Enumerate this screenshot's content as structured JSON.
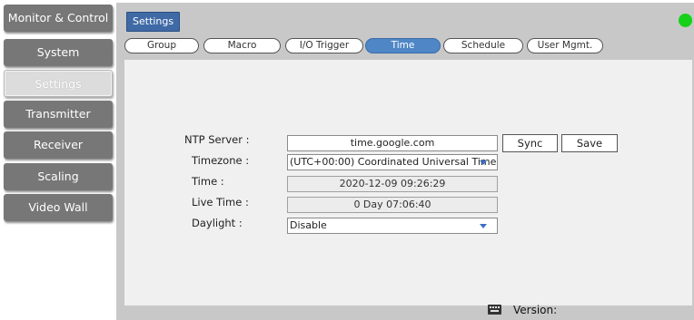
{
  "nav": {
    "items": [
      {
        "label": "Monitor & Control"
      },
      {
        "label": "System"
      },
      {
        "label": "Settings"
      },
      {
        "label": "Transmitter"
      },
      {
        "label": "Receiver"
      },
      {
        "label": "Scaling"
      },
      {
        "label": "Video Wall"
      }
    ],
    "active": "Settings"
  },
  "header": {
    "title": "Settings",
    "status_color": "#16d11a"
  },
  "tabs": [
    {
      "label": "Group"
    },
    {
      "label": "Macro"
    },
    {
      "label": "I/O Trigger"
    },
    {
      "label": "Time"
    },
    {
      "label": "Schedule"
    },
    {
      "label": "User Mgmt."
    }
  ],
  "active_tab": "Time",
  "form": {
    "ntp_server": {
      "label": "NTP Server :",
      "value": "time.google.com"
    },
    "sync_label": "Sync",
    "save_label": "Save",
    "timezone": {
      "label": "Timezone :",
      "value": "(UTC+00:00) Coordinated Universal Time"
    },
    "time": {
      "label": "Time :",
      "value": "2020-12-09 09:26:29"
    },
    "live_time": {
      "label": "Live Time :",
      "value": "0 Day 07:06:40"
    },
    "daylight": {
      "label": "Daylight :",
      "value": "Disable"
    }
  },
  "footer": {
    "version_label": "Version:",
    "keyboard_icon": "keyboard-icon"
  },
  "colors": {
    "nav_bg": "#777777",
    "accent": "#4f86c6",
    "title_chip": "#3f6aa6",
    "panel": "#c8c8c8",
    "content": "#f0f0f0"
  }
}
